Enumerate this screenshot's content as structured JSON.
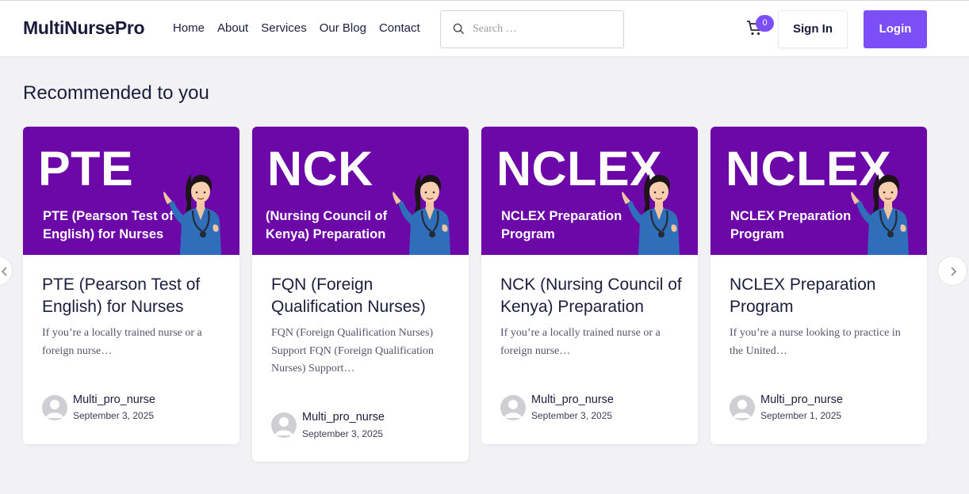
{
  "header": {
    "logo": "MultiNursePro",
    "nav": [
      "Home",
      "About",
      "Services",
      "Our Blog",
      "Contact"
    ],
    "search_placeholder": "Search …",
    "cart_count": "0",
    "signin_label": "Sign In",
    "login_label": "Login"
  },
  "section_title": "Recommended to you",
  "colors": {
    "accent": "#7c4ef8",
    "banner": "#6d08a8",
    "text": "#1c1d3d"
  },
  "cards": [
    {
      "banner_title": "PTE",
      "banner_subtitle": "PTE (Pearson Test of English) for Nurses",
      "title": "PTE (Pearson Test of English) for Nurses",
      "excerpt": "If you’re a locally trained nurse or a foreign nurse…",
      "author": "Multi_pro_nurse",
      "date": "September 3, 2025"
    },
    {
      "banner_title": "NCK",
      "banner_subtitle": "(Nursing Council of Kenya) Preparation",
      "title": "FQN (Foreign Qualification Nurses)",
      "excerpt": "FQN (Foreign Qualification Nurses) Support FQN (Foreign Qualification Nurses) Support…",
      "author": "Multi_pro_nurse",
      "date": "September 3, 2025"
    },
    {
      "banner_title": "NCLEX",
      "banner_subtitle": "NCLEX Preparation Program",
      "title": "NCK (Nursing Council of Kenya) Preparation",
      "excerpt": "If you’re a locally trained nurse or a foreign nurse…",
      "author": "Multi_pro_nurse",
      "date": "September 3, 2025"
    },
    {
      "banner_title": "NCLEX",
      "banner_subtitle": "NCLEX Preparation Program",
      "title": "NCLEX Preparation Program",
      "excerpt": "If you’re a nurse looking to practice in the United…",
      "author": "Multi_pro_nurse",
      "date": "September 1, 2025"
    }
  ],
  "icons": {
    "search": "search-icon",
    "cart": "cart-icon",
    "prev": "chevron-left-icon",
    "next": "chevron-right-icon"
  }
}
